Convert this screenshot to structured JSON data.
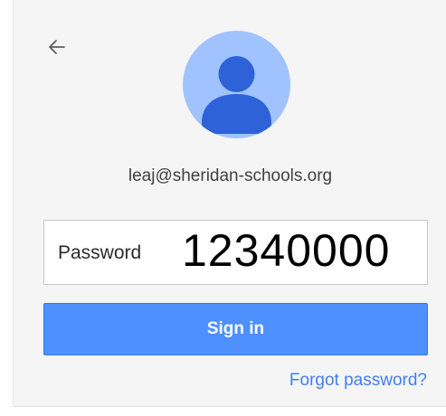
{
  "account": {
    "email": "leaj@sheridan-schools.org"
  },
  "password": {
    "label": "Password",
    "value": "12340000"
  },
  "actions": {
    "sign_in_label": "Sign in",
    "forgot_label": "Forgot password?"
  },
  "icons": {
    "back": "arrow-back-icon",
    "avatar": "default-user-avatar-icon"
  },
  "colors": {
    "card_background": "#f5f5f5",
    "avatar_background": "#a0c3ff",
    "avatar_figure": "#2d62d8",
    "button_background": "#4d90fe",
    "link": "#427fed"
  }
}
